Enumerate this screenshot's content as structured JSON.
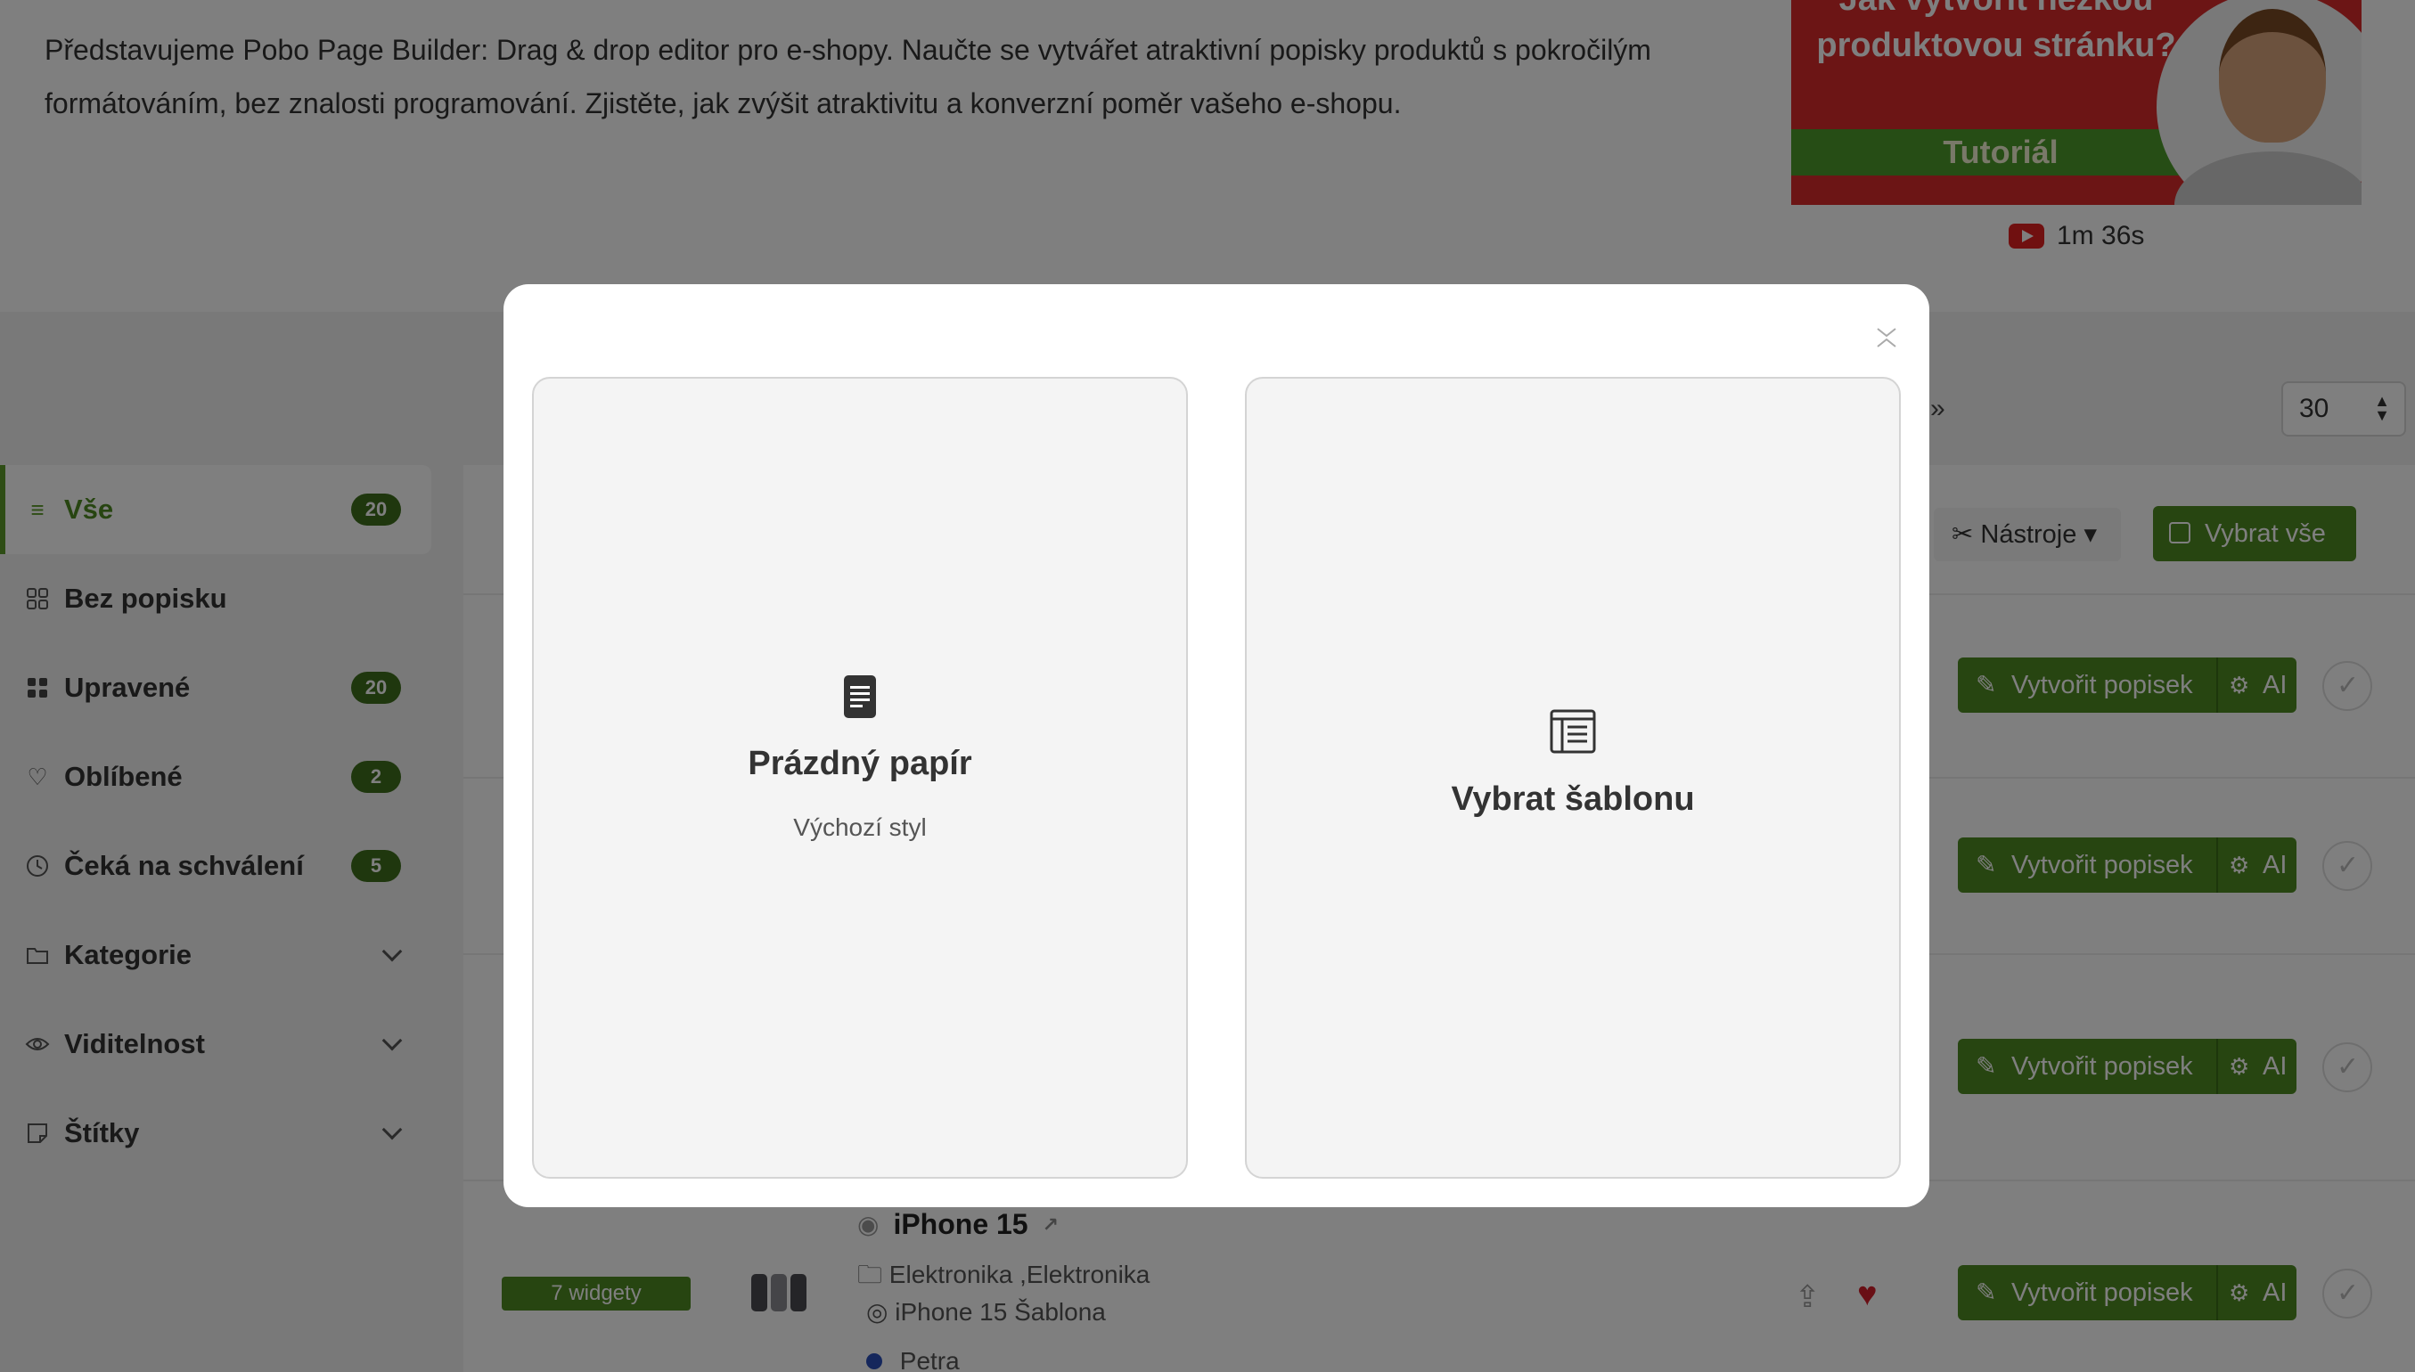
{
  "intro": {
    "text": "Představujeme Pobo Page Builder: Drag & drop editor pro e-shopy. Naučte se vytvářet atraktivní popisky produktů s pokročilým formátováním, bez znalosti programování. Zjistěte, jak zvýšit atraktivitu a konverzní poměr vašeho e-shopu."
  },
  "video": {
    "title_line1": "Jak vytvořit hezkou",
    "title_line2": "produktovou stránku?",
    "band": "Tutoriál",
    "duration": "1m 36s"
  },
  "pager": {
    "next": "»",
    "per_page": "30"
  },
  "sidebar": {
    "items": [
      {
        "label": "Vše",
        "count": "20"
      },
      {
        "label": "Bez popisku"
      },
      {
        "label": "Upravené",
        "count": "20"
      },
      {
        "label": "Oblíbené",
        "count": "2"
      },
      {
        "label": "Čeká na schválení",
        "count": "5"
      },
      {
        "label": "Kategorie"
      },
      {
        "label": "Viditelnost"
      },
      {
        "label": "Štítky"
      }
    ]
  },
  "toolbar": {
    "tools_label": "Nástroje",
    "select_all_label": "Vybrat vše"
  },
  "row_actions": {
    "create_label": "Vytvořit popisek",
    "ai_label": "AI"
  },
  "product": {
    "widgets": "7 widgety",
    "title": "iPhone 15",
    "category": "Elektronika ,Elektronika",
    "template": "iPhone 15 Šablona",
    "user": "Petra"
  },
  "modal": {
    "options": [
      {
        "title": "Prázdný papír",
        "subtitle": "Výchozí styl"
      },
      {
        "title": "Vybrat šablonu"
      }
    ]
  },
  "colors": {
    "accent": "#4e8a22",
    "badge": "#3e6f1d",
    "heart": "#d21f2a"
  }
}
